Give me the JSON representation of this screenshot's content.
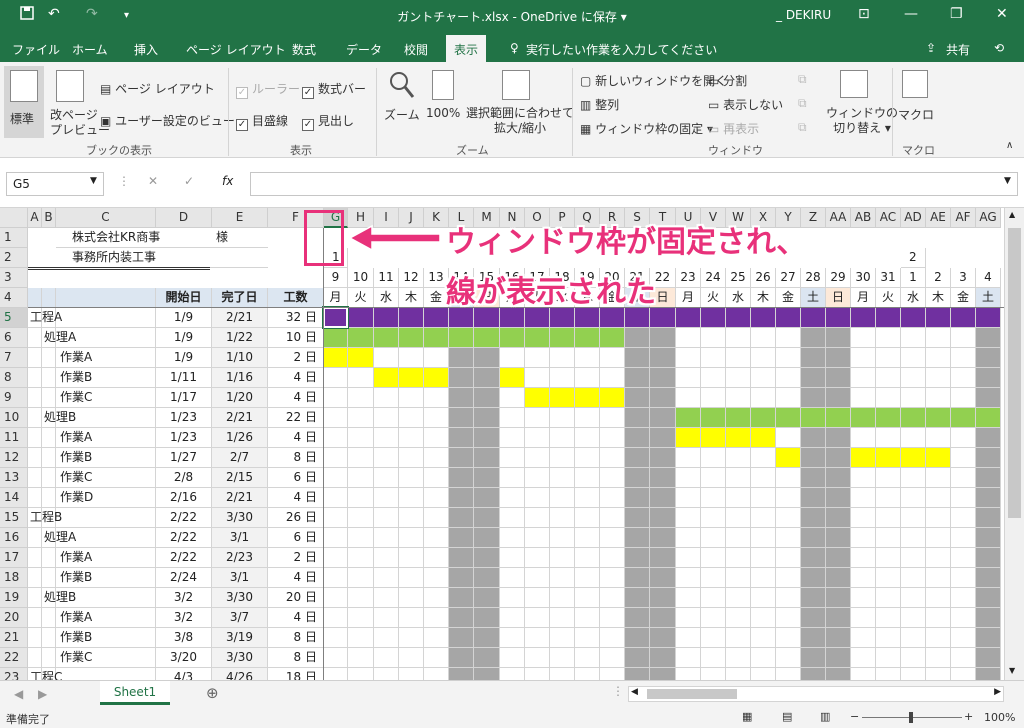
{
  "titlebar": {
    "title": "ガントチャート.xlsx  -  OneDrive に保存 ▾",
    "user": "_ DEKIRU",
    "qa_more": "▾",
    "save_icon": "save-icon",
    "undo_icon": "undo-icon",
    "redo_icon": "redo-icon"
  },
  "tabs": [
    "ファイル",
    "ホーム",
    "挿入",
    "ページ レイアウト",
    "数式",
    "データ",
    "校閲",
    "表示"
  ],
  "tell_me": "実行したい作業を入力してください",
  "share": "共有",
  "ribbon": {
    "standard": "標準",
    "page_break": "改ページ\nプレビュー",
    "page_layout": "ページ レイアウト",
    "custom_view": "ユーザー設定のビュー",
    "group_book": "ブックの表示",
    "ruler": "ルーラー",
    "formula_bar": "数式バー",
    "gridlines": "目盛線",
    "headings": "見出し",
    "group_show": "表示",
    "zoom": "ズーム",
    "zoom100": "100%",
    "zoom_sel": "選択範囲に合わせて\n拡大/縮小",
    "group_zoom": "ズーム",
    "new_window": "新しいウィンドウを開く",
    "arrange": "整列",
    "freeze": "ウィンドウ枠の固定 ▾",
    "split": "分割",
    "hide": "表示しない",
    "unhide": "再表示",
    "switch": "ウィンドウの\n切り替え ▾",
    "group_window": "ウィンドウ",
    "macro": "マクロ",
    "group_macro": "マクロ"
  },
  "namebox": "G5",
  "fx": "fx",
  "columns": [
    "A",
    "B",
    "C",
    "D",
    "E",
    "F",
    "G",
    "H",
    "I",
    "J",
    "K",
    "L",
    "M",
    "N",
    "O",
    "P",
    "Q",
    "R",
    "S",
    "T",
    "U",
    "V",
    "W",
    "X",
    "Y",
    "Z",
    "AA",
    "AB",
    "AC",
    "AD",
    "AE",
    "AF",
    "AG"
  ],
  "company": "株式会社KR商事",
  "sama": "様",
  "project": "事務所内装工事",
  "month1": "1",
  "month2": "2",
  "headers": {
    "start": "開始日",
    "end": "完了日",
    "days": "工数"
  },
  "dates": [
    "9",
    "10",
    "11",
    "12",
    "13",
    "14",
    "15",
    "16",
    "17",
    "18",
    "19",
    "20",
    "21",
    "22",
    "23",
    "24",
    "25",
    "26",
    "27",
    "28",
    "29",
    "30",
    "31",
    "1",
    "2",
    "3",
    "4"
  ],
  "weekdays": [
    "月",
    "火",
    "水",
    "木",
    "金",
    "土",
    "日",
    "月",
    "火",
    "水",
    "木",
    "金",
    "土",
    "日",
    "月",
    "火",
    "水",
    "木",
    "金",
    "土",
    "日",
    "月",
    "火",
    "水",
    "木",
    "金",
    "土"
  ],
  "rows": [
    {
      "name": "工程A",
      "start": "1/9",
      "end": "2/21",
      "days": "32 日"
    },
    {
      "name": "処理A",
      "start": "1/9",
      "end": "1/22",
      "days": "10 日"
    },
    {
      "name": "作業A",
      "start": "1/9",
      "end": "1/10",
      "days": "2 日"
    },
    {
      "name": "作業B",
      "start": "1/11",
      "end": "1/16",
      "days": "4 日"
    },
    {
      "name": "作業C",
      "start": "1/17",
      "end": "1/20",
      "days": "4 日"
    },
    {
      "name": "処理B",
      "start": "1/23",
      "end": "2/21",
      "days": "22 日"
    },
    {
      "name": "作業A",
      "start": "1/23",
      "end": "1/26",
      "days": "4 日"
    },
    {
      "name": "作業B",
      "start": "1/27",
      "end": "2/7",
      "days": "8 日"
    },
    {
      "name": "作業C",
      "start": "2/8",
      "end": "2/15",
      "days": "6 日"
    },
    {
      "name": "作業D",
      "start": "2/16",
      "end": "2/21",
      "days": "4 日"
    },
    {
      "name": "工程B",
      "start": "2/22",
      "end": "3/30",
      "days": "26 日"
    },
    {
      "name": "処理A",
      "start": "2/22",
      "end": "3/1",
      "days": "6 日"
    },
    {
      "name": "作業A",
      "start": "2/22",
      "end": "2/23",
      "days": "2 日"
    },
    {
      "name": "作業B",
      "start": "2/24",
      "end": "3/1",
      "days": "4 日"
    },
    {
      "name": "処理B",
      "start": "3/2",
      "end": "3/30",
      "days": "20 日"
    },
    {
      "name": "作業A",
      "start": "3/2",
      "end": "3/7",
      "days": "4 日"
    },
    {
      "name": "作業B",
      "start": "3/8",
      "end": "3/19",
      "days": "8 日"
    },
    {
      "name": "作業C",
      "start": "3/20",
      "end": "3/30",
      "days": "8 日"
    },
    {
      "name": "工程C",
      "start": "4/3",
      "end": "4/26",
      "days": "18 日"
    }
  ],
  "sheet_tab": "Sheet1",
  "status": "準備完了",
  "zoom_level": "100%",
  "annotation": "ウィンドウ枠が固定され、\n線が表示された",
  "colors": {
    "excel_green": "#217346",
    "phase": "#7030a0",
    "process": "#92d050",
    "task": "#ffff00",
    "weekend": "#a6a6a6",
    "accent": "#e8317a"
  }
}
